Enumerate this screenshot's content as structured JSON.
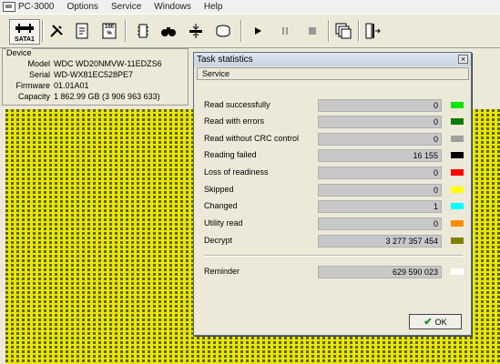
{
  "menu": {
    "app_title": "PC-3000",
    "items": [
      "Options",
      "Service",
      "Windows",
      "Help"
    ]
  },
  "toolbar": {
    "sata_label": "SATA1",
    "percent_label": "100 %"
  },
  "device": {
    "legend": "Device",
    "fields": [
      {
        "key": "Model",
        "value": "WDC WD20NMVW-11EDZS6"
      },
      {
        "key": "Serial",
        "value": "WD-WX81EC528PE7"
      },
      {
        "key": "Firmware",
        "value": "01.01A01"
      },
      {
        "key": "Capacity",
        "value": "1 862.99 GB (3 906 963 633)"
      }
    ]
  },
  "dialog": {
    "title": "Task statistics",
    "close_label": "×",
    "tab": "Service",
    "stats": [
      {
        "label": "Read successfully",
        "value": "0",
        "color": "#00e600"
      },
      {
        "label": "Read with errors",
        "value": "0",
        "color": "#0a7a0a"
      },
      {
        "label": "Read without CRC control",
        "value": "0",
        "color": "#a0a0a0"
      },
      {
        "label": "Reading failed",
        "value": "16 155",
        "color": "#000000"
      },
      {
        "label": "Loss of readiness",
        "value": "0",
        "color": "#ff0000"
      },
      {
        "label": "Skipped",
        "value": "0",
        "color": "#ffff00"
      },
      {
        "label": "Changed",
        "value": "1",
        "color": "#00ffff"
      },
      {
        "label": "Utility read",
        "value": "0",
        "color": "#ff8c00"
      },
      {
        "label": "Decrypt",
        "value": "3 277 357 454",
        "color": "#808000"
      }
    ],
    "reminder": {
      "label": "Reminder",
      "value": "629 590 023",
      "color": "#ffffff"
    },
    "ok_label": "OK"
  },
  "colors": {
    "grid_fill": "#e6e60a",
    "grid_border": "#646400"
  }
}
